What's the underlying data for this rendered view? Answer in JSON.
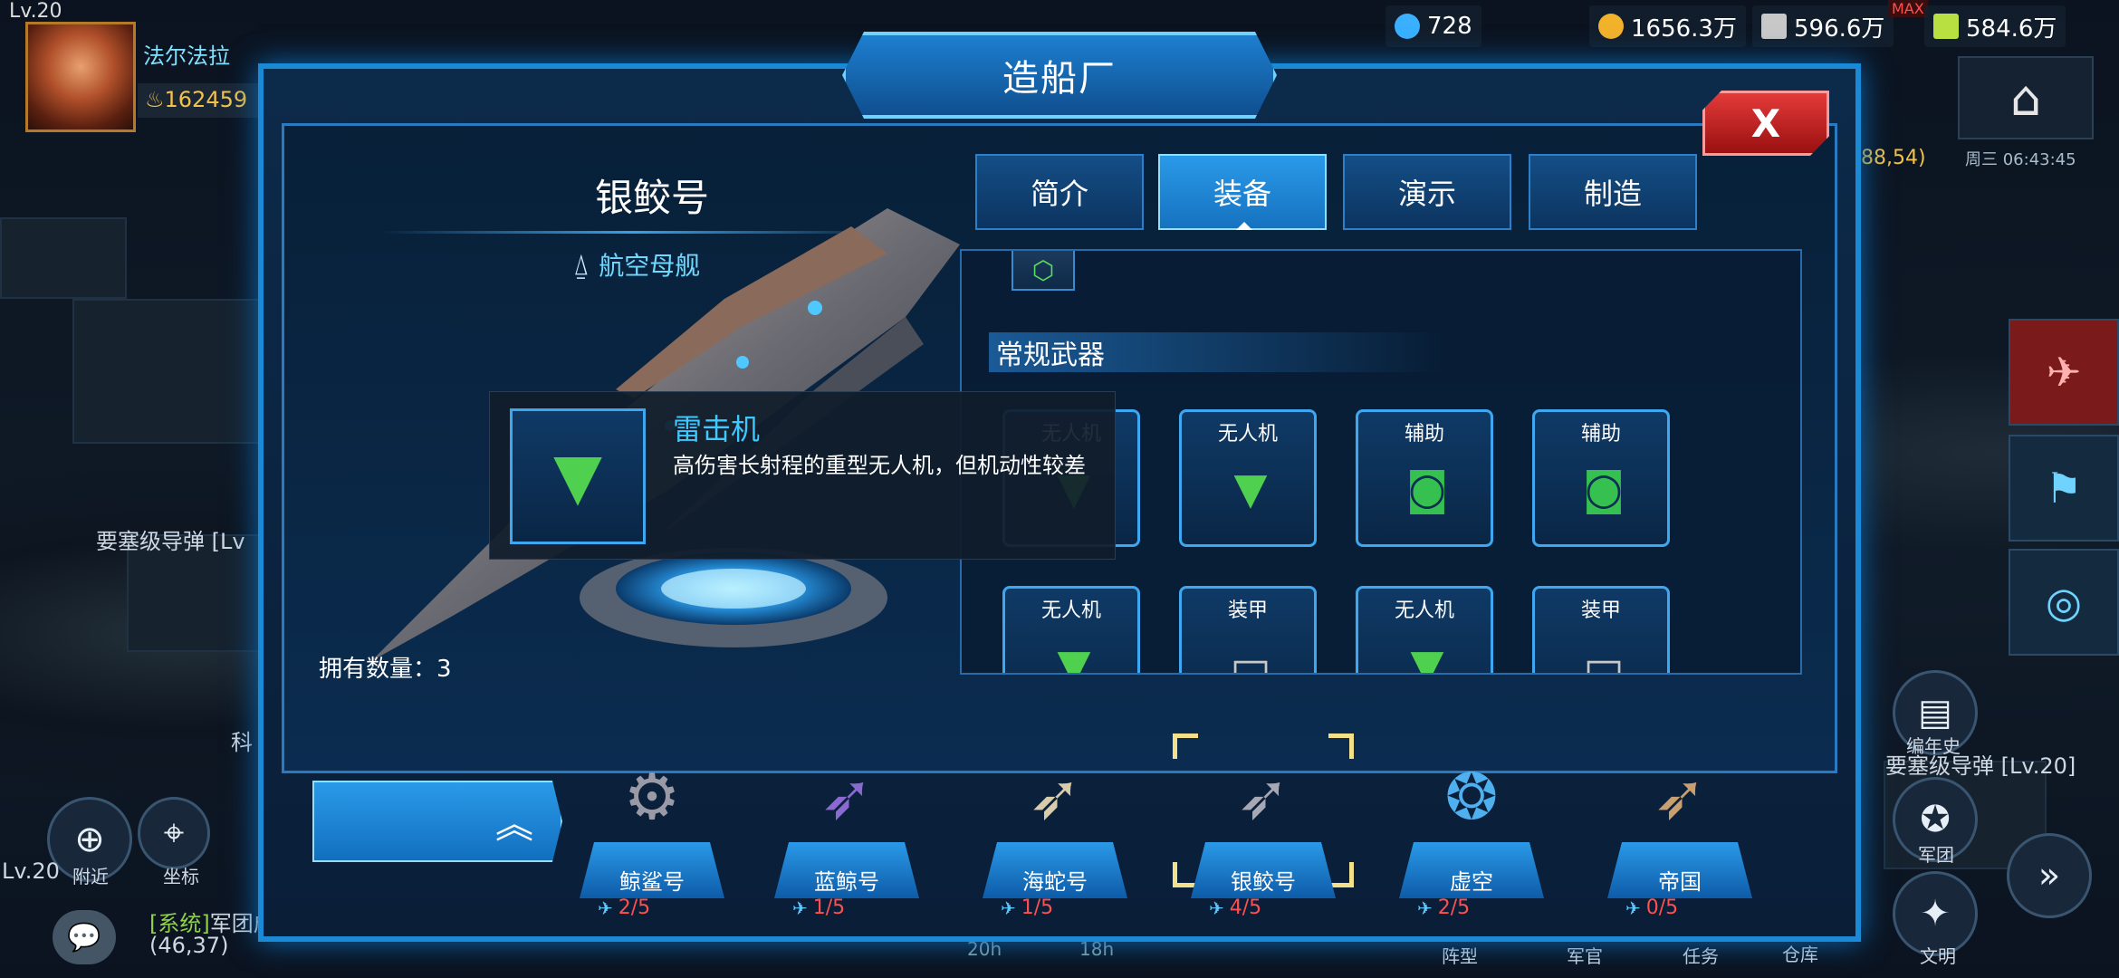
{
  "player": {
    "level": "Lv.20",
    "name": "法尔法拉",
    "power": "162459"
  },
  "resources": [
    {
      "name": "diamond",
      "value": "728",
      "color": "#3ab0ff"
    },
    {
      "name": "gold",
      "value": "1656.3万",
      "color": "#f2b22a"
    },
    {
      "name": "metal",
      "value": "596.6万",
      "color": "#c8c8c8"
    },
    {
      "name": "crystal",
      "value": "584.6万",
      "color": "#b8e040"
    }
  ],
  "max_tag": "MAX",
  "map": {
    "coord": "88,54)",
    "clock": "周三 06:43:45",
    "label_left": "要塞级导弹 [Lv",
    "label_right": "要塞级导弹 [Lv.20]",
    "ko": "科",
    "lv_near": "Lv.20",
    "near": "附近",
    "coord_btn": "坐标",
    "history": "编年史",
    "legion": "军团",
    "officer": "军官",
    "task": "任务",
    "formation": "阵型",
    "warehouse": "仓库",
    "civ": "文明",
    "nums": [
      "20h",
      "18h"
    ]
  },
  "chat": {
    "sys_tag": "[系统]",
    "sys_text": "军团成",
    "sys_coord": "(46,37)"
  },
  "dialog": {
    "title": "造船厂",
    "close": "X"
  },
  "ship": {
    "name": "银鲛号",
    "class": "航空母舰",
    "owned": "拥有数量：3"
  },
  "tabs": [
    {
      "label": "简介"
    },
    {
      "label": "装备",
      "active": true
    },
    {
      "label": "演示"
    },
    {
      "label": "制造"
    }
  ],
  "equip": {
    "section": "常规武器",
    "slots": [
      {
        "label": "无人机",
        "type": "drone"
      },
      {
        "label": "无人机",
        "type": "drone"
      },
      {
        "label": "辅助",
        "type": "aux"
      },
      {
        "label": "辅助",
        "type": "aux"
      },
      {
        "label": "无人机",
        "type": "drone"
      },
      {
        "label": "装甲",
        "type": "armor"
      },
      {
        "label": "无人机",
        "type": "drone"
      },
      {
        "label": "装甲",
        "type": "armor"
      }
    ]
  },
  "tooltip": {
    "name": "雷击机",
    "desc": "高伤害长射程的重型无人机，但机动性较差"
  },
  "fleet": [
    {
      "name": "鲸鲨号",
      "count": "2/5"
    },
    {
      "name": "蓝鲸号",
      "count": "1/5"
    },
    {
      "name": "海蛇号",
      "count": "1/5"
    },
    {
      "name": "银鲛号",
      "count": "4/5",
      "selected": true
    },
    {
      "name": "虚空",
      "count": "2/5"
    },
    {
      "name": "帝国",
      "count": "0/5"
    }
  ]
}
